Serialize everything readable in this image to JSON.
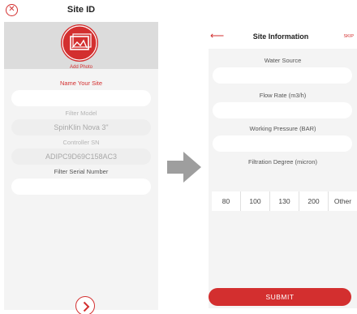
{
  "left": {
    "title": "Site ID",
    "add_photo": "Add Photo",
    "name_site_label": "Name Your Site",
    "filter_model_label": "Filter Model",
    "filter_model_value": "SpinKlin Nova 3\"",
    "controller_sn_label": "Controller SN",
    "controller_sn_value": "ADIPC9D69C158AC3",
    "filter_serial_label": "Filter Serial Number",
    "icons": {
      "close": "close-circle-icon",
      "photo": "photo-icon",
      "next": "chevron-right-icon"
    }
  },
  "right": {
    "title": "Site Information",
    "skip": "SKIP",
    "water_source_label": "Water Source",
    "flow_rate_label": "Flow Rate (m3/h)",
    "working_pressure_label": "Working Pressure (BAR)",
    "filtration_degree_label": "Filtration Degree (micron)",
    "degree_options": [
      "80",
      "100",
      "130",
      "200",
      "Other"
    ],
    "submit": "SUBMIT",
    "icons": {
      "back": "back-arrow-icon"
    }
  },
  "colors": {
    "accent": "#d32f2f",
    "background": "#f4f4f4",
    "arrow": "#9e9e9e"
  }
}
